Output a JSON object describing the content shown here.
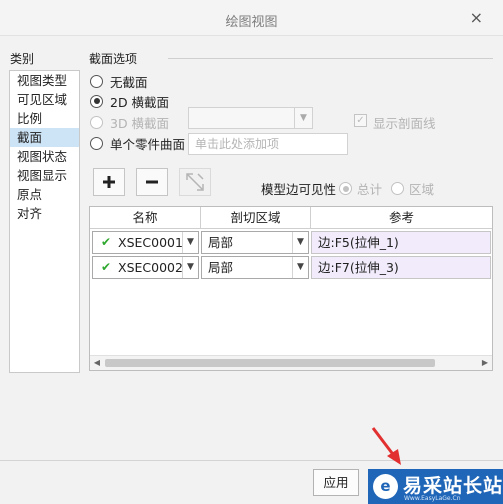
{
  "window": {
    "title": "绘图视图",
    "close_symbol": "×"
  },
  "categories": {
    "label": "类别",
    "items": [
      "视图类型",
      "可见区域",
      "比例",
      "截面",
      "视图状态",
      "视图显示",
      "原点",
      "对齐"
    ],
    "selected": "截面"
  },
  "section_options": {
    "title": "截面选项",
    "radios": [
      {
        "label": "无截面",
        "selected": false,
        "enabled": true
      },
      {
        "label": "2D 横截面",
        "selected": true,
        "enabled": true
      },
      {
        "label": "3D 横截面",
        "selected": false,
        "enabled": false
      },
      {
        "label": "单个零件曲面",
        "selected": false,
        "enabled": true
      }
    ],
    "show_hatch_label": "显示剖面线",
    "add_item_placeholder": "单击此处添加项"
  },
  "toolbar": {
    "model_edge_visibility_label": "模型边可见性",
    "total_label": "总计",
    "area_label": "区域"
  },
  "table": {
    "headers": [
      "名称",
      "剖切区域",
      "参考"
    ],
    "rows": [
      {
        "name": "XSEC0001",
        "region": "局部",
        "reference": "边:F5(拉伸_1)"
      },
      {
        "name": "XSEC0002",
        "region": "局部",
        "reference": "边:F7(拉伸_3)"
      }
    ]
  },
  "footer": {
    "apply_label": "应用"
  },
  "watermark": {
    "text": "易采站长站",
    "logo_char": "e",
    "url": "Www.EasyLaGe.Cn"
  },
  "colors": {
    "selection": "#cde4f7",
    "check": "#2fa82f",
    "reference_bg": "#f1ebfb",
    "arrow": "#e23030",
    "watermark_bg": "#1f66b8"
  }
}
